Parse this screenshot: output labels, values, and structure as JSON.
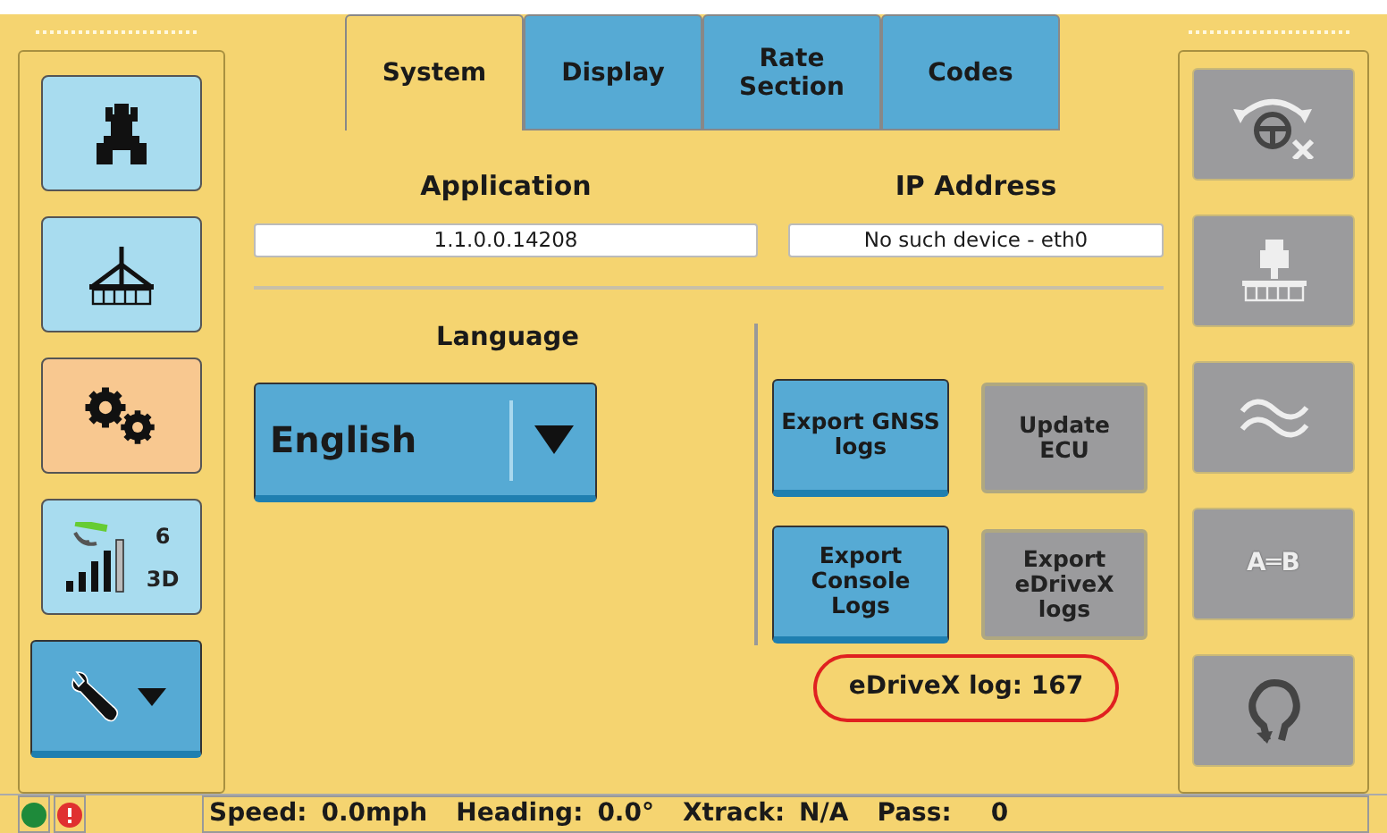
{
  "tabs": [
    {
      "label": "System",
      "selected": true
    },
    {
      "label": "Display",
      "selected": false
    },
    {
      "label": "Rate Section",
      "selected": false
    },
    {
      "label": "Codes",
      "selected": false
    }
  ],
  "left_buttons": [
    {
      "kind": "tractor",
      "selected": false
    },
    {
      "kind": "implement",
      "selected": false
    },
    {
      "kind": "settings",
      "selected": true
    },
    {
      "kind": "gnss",
      "selected": false,
      "satellites": "6",
      "fix": "3D"
    },
    {
      "kind": "tools",
      "selected": false
    }
  ],
  "application": {
    "label": "Application",
    "value": "1.1.0.0.14208"
  },
  "ip_address": {
    "label": "IP Address",
    "value": "No such device - eth0"
  },
  "language": {
    "label": "Language",
    "value": "English"
  },
  "actions": [
    {
      "label": "Export GNSS logs",
      "disabled": false
    },
    {
      "label": "Update ECU",
      "disabled": true
    },
    {
      "label": "Export Console Logs",
      "disabled": false
    },
    {
      "label": "Export eDriveX logs",
      "disabled": true
    }
  ],
  "log_count": {
    "text": "eDriveX log: 167",
    "highlighted": true
  },
  "right_buttons": [
    {
      "kind": "steering",
      "disabled": true
    },
    {
      "kind": "implement",
      "disabled": true
    },
    {
      "kind": "curve",
      "disabled": true
    },
    {
      "kind": "ab_line",
      "label": "A═B",
      "disabled": true
    },
    {
      "kind": "pivot",
      "disabled": true
    }
  ],
  "indicators": [
    {
      "kind": "ok",
      "color": "#1e8a3a"
    },
    {
      "kind": "alert",
      "color": "#e03030"
    }
  ],
  "status": [
    {
      "label": "Speed:",
      "value": "0.0mph"
    },
    {
      "label": "Heading:",
      "value": "0.0°"
    },
    {
      "label": "Xtrack:",
      "value": "N/A"
    },
    {
      "label": "Pass:",
      "value": "0"
    }
  ]
}
